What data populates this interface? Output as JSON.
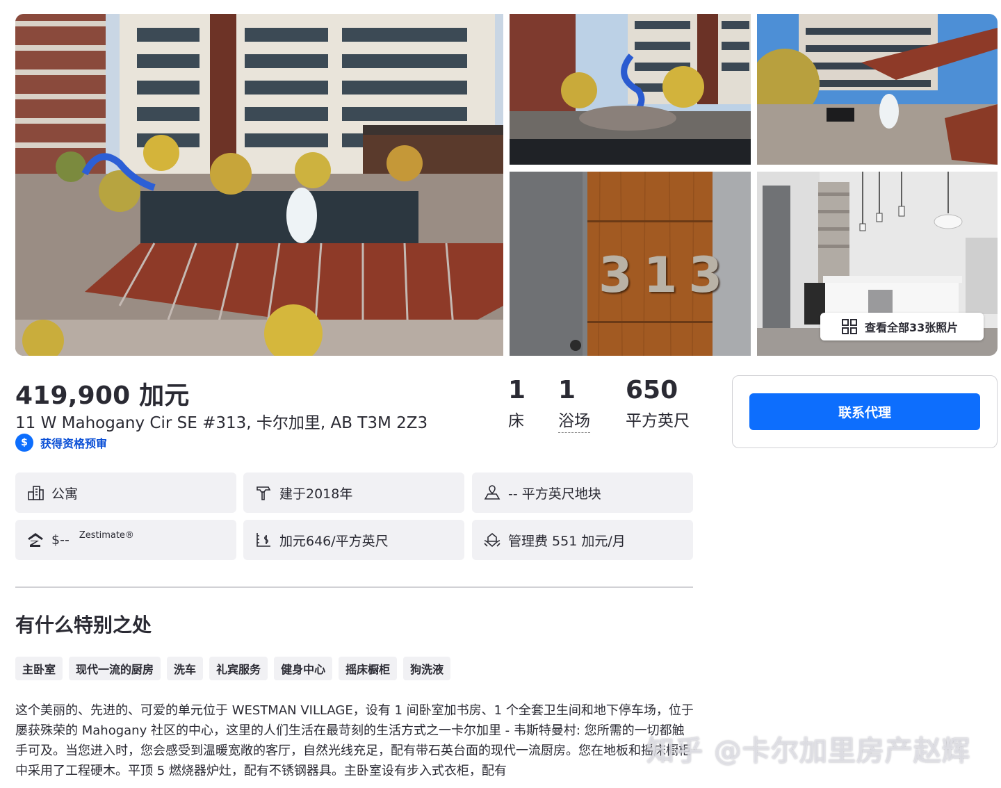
{
  "gallery": {
    "view_all_label": "查看全部33张照片",
    "door_number": "313"
  },
  "listing": {
    "price": "419,900 加元",
    "address": "11 W Mahogany Cir SE #313, 卡尔加里, AB T3M 2Z3",
    "prequal_label": "获得资格预审",
    "beds": {
      "num": "1",
      "label": "床"
    },
    "baths": {
      "num": "1",
      "label": "浴场"
    },
    "sqft": {
      "num": "650",
      "label": "平方英尺"
    }
  },
  "contact": {
    "button_label": "联系代理"
  },
  "facts": {
    "type": "公寓",
    "built": "建于2018年",
    "lot": "-- 平方英尺地块",
    "zestimate_value": "$--",
    "zestimate_label": "Zestimate®",
    "price_per_sqft": "加元646/平方英尺",
    "hoa": "管理费 551 加元/月"
  },
  "special": {
    "title": "有什么特别之处",
    "tags": [
      "主卧室",
      "现代一流的厨房",
      "洗车",
      "礼宾服务",
      "健身中心",
      "摇床橱柜",
      "狗洗液"
    ],
    "description": "这个美丽的、先进的、可爱的单元位于 WESTMAN VILLAGE，设有 1 间卧室加书房、1 个全套卫生间和地下停车场，位于屡获殊荣的 Mahogany 社区的中心，这里的人们生活在最苛刻的生活方式之一卡尔加里 - 韦斯特曼村: 您所需的一切都触手可及。当您进入时，您会感受到温暖宽敞的客厅，自然光线充足，配有带石英台面的现代一流厨房。您在地板和摇床橱柜中采用了工程硬木。平顶 5 燃烧器炉灶，配有不锈钢器具。主卧室设有步入式衣柜，配有"
  },
  "watermark": "知乎 @卡尔加里房产赵辉",
  "colors": {
    "accent": "#0d6efd",
    "text": "#2a2a33",
    "tile_bg": "#f1f1f4"
  }
}
